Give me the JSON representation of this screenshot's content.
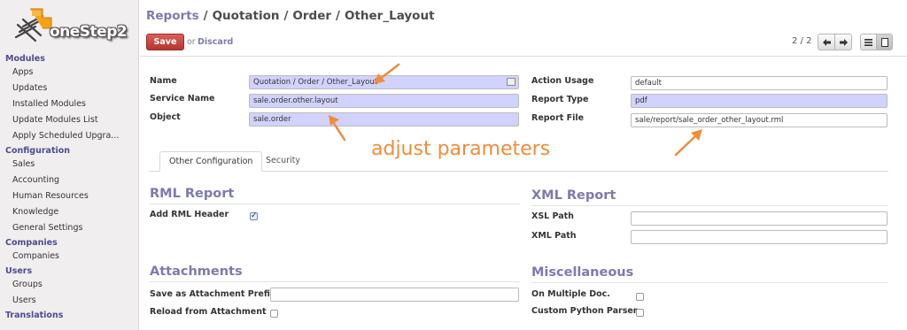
{
  "app": {
    "logo_text": "oneStep2"
  },
  "sidebar": {
    "sections": [
      {
        "title": "Modules",
        "items": [
          "Apps",
          "Updates",
          "Installed Modules",
          "Update Modules List",
          "Apply Scheduled Upgra..."
        ]
      },
      {
        "title": "Configuration",
        "items": [
          "Sales",
          "Accounting",
          "Human Resources",
          "Knowledge",
          "General Settings"
        ]
      },
      {
        "title": "Companies",
        "items": [
          "Companies"
        ]
      },
      {
        "title": "Users",
        "items": [
          "Groups",
          "Users"
        ]
      },
      {
        "title": "Translations",
        "items": []
      }
    ]
  },
  "header": {
    "breadcrumb": [
      "Reports",
      "Quotation",
      "Order",
      "Other_Layout"
    ],
    "save_label": "Save",
    "or_label": "or",
    "discard_label": "Discard",
    "pager": "2 / 2",
    "prev_icon": "arrow-left-icon",
    "next_icon": "arrow-right-icon",
    "list_view_icon": "list-view-icon",
    "form_view_icon": "form-view-icon"
  },
  "form": {
    "name_label": "Name",
    "name_value": "Quotation / Order / Other_Layout",
    "service_name_label": "Service Name",
    "service_name_value": "sale.order.other.layout",
    "object_label": "Object",
    "object_value": "sale.order",
    "action_usage_label": "Action Usage",
    "action_usage_value": "default",
    "report_type_label": "Report Type",
    "report_type_value": "pdf",
    "report_file_label": "Report File",
    "report_file_value": "sale/report/sale_order_other_layout.rml"
  },
  "tabs": [
    {
      "label": "Other Configuration",
      "active": true
    },
    {
      "label": "Security",
      "active": false
    }
  ],
  "rml": {
    "title": "RML Report",
    "header_label": "Add RML Header",
    "header_checked": true
  },
  "xml": {
    "title": "XML Report",
    "xsl_label": "XSL Path",
    "xml_label": "XML Path",
    "xsl_value": "",
    "xml_value": ""
  },
  "attachments": {
    "title": "Attachments",
    "prefix_label": "Save as Attachment Prefix",
    "prefix_value": "",
    "reload_label": "Reload from Attachment",
    "reload_checked": false
  },
  "misc": {
    "title": "Miscellaneous",
    "multiple_label": "On Multiple Doc.",
    "multiple_checked": false,
    "parser_label": "Custom Python Parser",
    "parser_checked": false
  },
  "annotation": {
    "text": "adjust parameters"
  },
  "colors": {
    "accent": "#7c7bad",
    "required_bg": "#d2d2ff",
    "save_button": "#c1403a",
    "annotation": "#f08c3c"
  }
}
